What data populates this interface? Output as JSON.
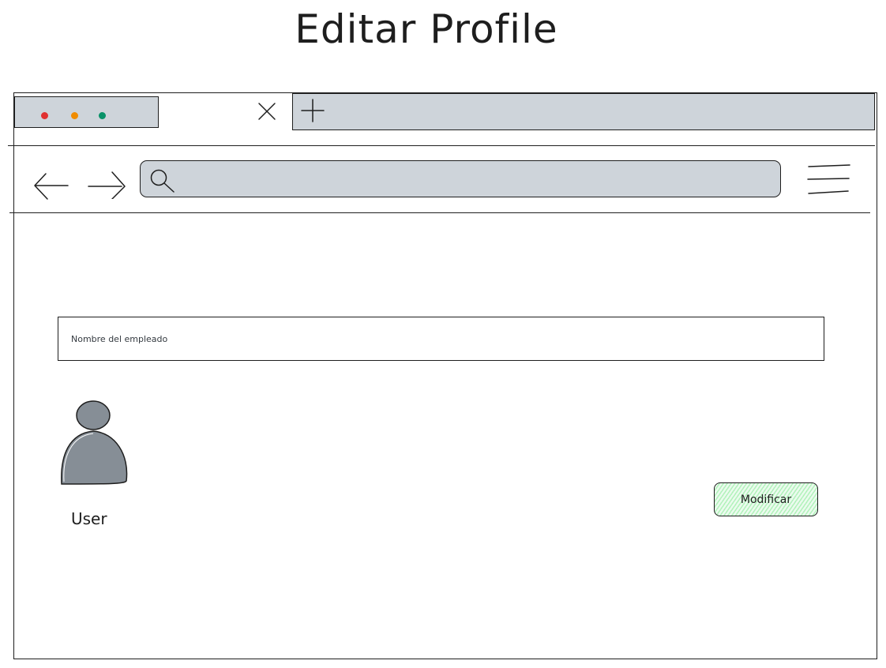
{
  "page": {
    "title": "Editar Profile"
  },
  "browser": {
    "window_controls": {
      "colors": [
        "#e03131",
        "#f08c00",
        "#099268"
      ]
    },
    "tab": {
      "close_icon": "close-icon"
    },
    "new_tab": {
      "icon": "plus-icon"
    },
    "toolbar": {
      "back_icon": "arrow-left-icon",
      "forward_icon": "arrow-right-icon",
      "search_icon": "search-icon",
      "menu_icon": "hamburger-menu-icon"
    }
  },
  "form": {
    "name_placeholder": "Nombre del empleado",
    "name_value": "",
    "avatar_icon": "user-avatar-icon",
    "user_label": "User",
    "modify_label": "Modificar",
    "modify_button_color": "#b2f2bb"
  }
}
